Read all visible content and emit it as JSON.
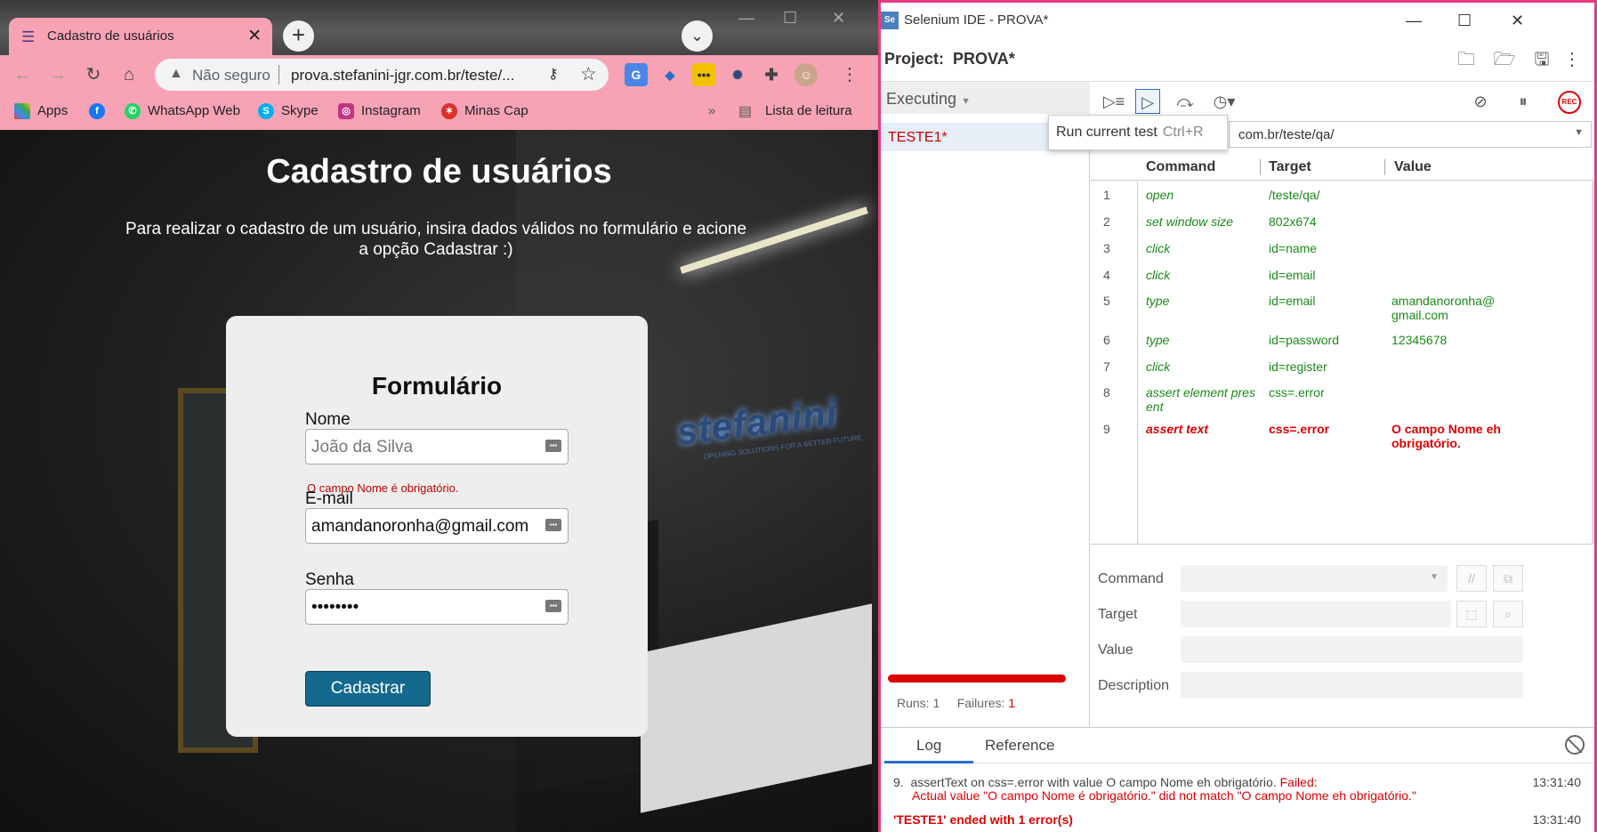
{
  "browser": {
    "tab_title": "Cadastro de usuários",
    "tab_close": "✕",
    "address": {
      "security_label": "Não seguro",
      "url": "prova.stefanini-jgr.com.br/teste/..."
    },
    "bookmarks": [
      "Apps",
      "WhatsApp Web",
      "Skype",
      "Instagram",
      "Minas Cap"
    ],
    "bookmarks_more": "»",
    "reading_list": "Lista de leitura"
  },
  "page": {
    "title": "Cadastro de usuários",
    "description": "Para realizar o cadastro de um usuário, insira dados válidos no formulário e acione a opção Cadastrar :)",
    "watermark": "stefanini",
    "watermark_sub": "OPENING SOLUTIONS FOR A BETTER FUTURE",
    "form": {
      "title": "Formulário",
      "name_label": "Nome",
      "name_placeholder": "João da Silva",
      "name_error": "O campo Nome é obrigatório.",
      "email_label": "E-mail",
      "email_value": "amandanoronha@gmail.com",
      "password_label": "Senha",
      "password_value": "••••••••",
      "submit_label": "Cadastrar"
    }
  },
  "selenium": {
    "window_title": "Selenium IDE - PROVA*",
    "project_label": "Project:",
    "project_name": "PROVA*",
    "executing_label": "Executing",
    "test_name": "TESTE1*",
    "tooltip": {
      "text": "Run current test",
      "shortcut": "Ctrl+R"
    },
    "base_url": "com.br/teste/qa/",
    "rec_label": "REC",
    "columns": [
      "Command",
      "Target",
      "Value"
    ],
    "rows": [
      {
        "n": "1",
        "command": "open",
        "target": "/teste/qa/",
        "value": ""
      },
      {
        "n": "2",
        "command": "set window size",
        "target": "802x674",
        "value": ""
      },
      {
        "n": "3",
        "command": "click",
        "target": "id=name",
        "value": ""
      },
      {
        "n": "4",
        "command": "click",
        "target": "id=email",
        "value": ""
      },
      {
        "n": "5",
        "command": "type",
        "target": "id=email",
        "value": "amandanoronha@ gmail.com"
      },
      {
        "n": "6",
        "command": "type",
        "target": "id=password",
        "value": "12345678"
      },
      {
        "n": "7",
        "command": "click",
        "target": "id=register",
        "value": ""
      },
      {
        "n": "8",
        "command": "assert element pres ent",
        "target": "css=.error",
        "value": ""
      },
      {
        "n": "9",
        "command": "assert text",
        "target": "css=.error",
        "value": "O campo Nome eh obrigatório."
      }
    ],
    "editor_labels": {
      "command": "Command",
      "target": "Target",
      "value": "Value",
      "description": "Description"
    },
    "runs_label": "Runs:",
    "runs": "1",
    "failures_label": "Failures:",
    "failures": "1",
    "log_tabs": [
      "Log",
      "Reference"
    ],
    "log": {
      "line1_prefix": "9.",
      "line1_text": "assertText on css=.error with value O campo Nome eh obrigatório.",
      "line1_failed": "Failed:",
      "line2": "Actual value \"O campo Nome é obrigatório.\" did not match \"O campo Nome eh obrigatório.\"",
      "time1": "13:31:40",
      "summary": "'TESTE1' ended with 1 error(s)",
      "time2": "13:31:40"
    }
  }
}
